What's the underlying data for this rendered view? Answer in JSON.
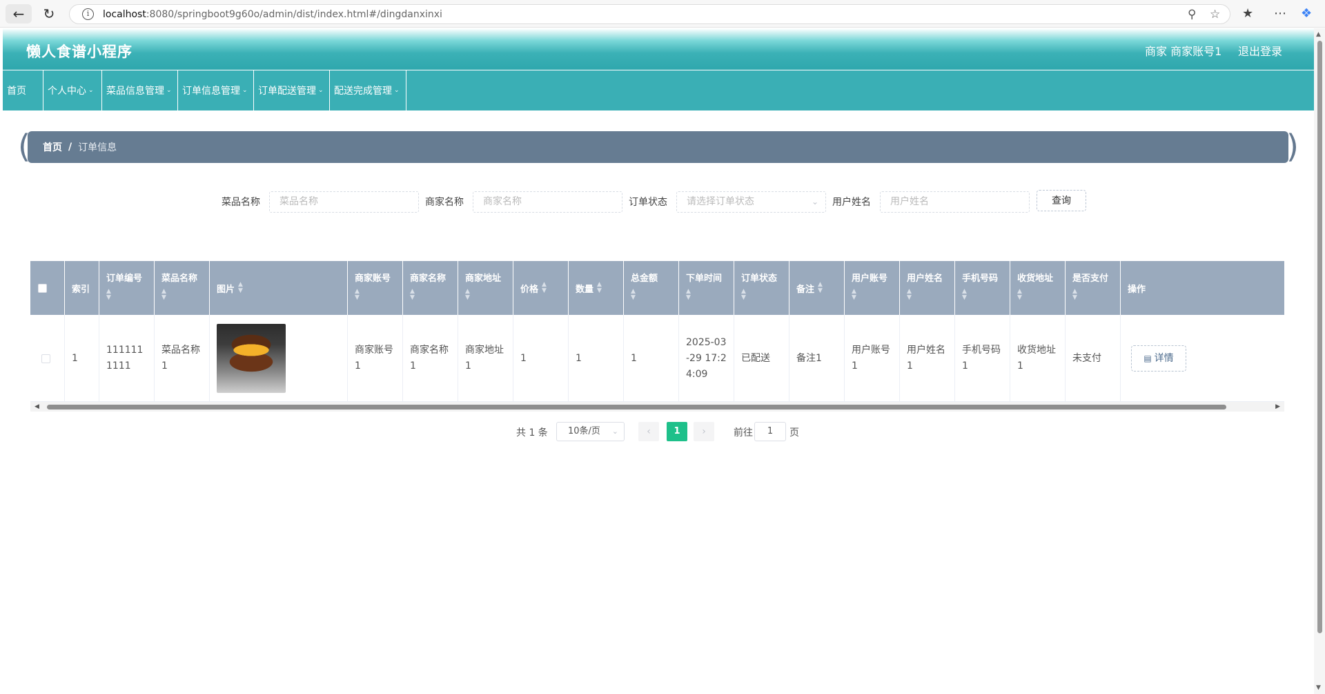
{
  "browser": {
    "url_host": "localhost",
    "url_rest": ":8080/springboot9g60o/admin/dist/index.html#/dingdanxinxi"
  },
  "header": {
    "title": "懒人食谱小程序",
    "user": "商家 商家账号1",
    "logout": "退出登录"
  },
  "menu": {
    "items": [
      {
        "label": "首页",
        "has_caret": false
      },
      {
        "label": "个人中心",
        "has_caret": true
      },
      {
        "label": "菜品信息管理",
        "has_caret": true
      },
      {
        "label": "订单信息管理",
        "has_caret": true
      },
      {
        "label": "订单配送管理",
        "has_caret": true
      },
      {
        "label": "配送完成管理",
        "has_caret": true
      }
    ]
  },
  "breadcrumb": {
    "home": "首页",
    "separator": "/",
    "current": "订单信息"
  },
  "search": {
    "fields": [
      {
        "label": "菜品名称",
        "placeholder": "菜品名称"
      },
      {
        "label": "商家名称",
        "placeholder": "商家名称"
      },
      {
        "label": "订单状态",
        "placeholder": "请选择订单状态"
      },
      {
        "label": "用户姓名",
        "placeholder": "用户姓名"
      }
    ],
    "query_button": "查询"
  },
  "table": {
    "columns": [
      "索引",
      "订单编号",
      "菜品名称",
      "图片",
      "商家账号",
      "商家名称",
      "商家地址",
      "价格",
      "数量",
      "总金额",
      "下单时间",
      "订单状态",
      "备注",
      "用户账号",
      "用户姓名",
      "手机号码",
      "收货地址",
      "是否支付",
      "操作"
    ],
    "rows": [
      {
        "index": "1",
        "order_no": "1111111111",
        "dish_name": "菜品名称1",
        "merchant_account": "商家账号1",
        "merchant_name": "商家名称1",
        "merchant_address": "商家地址1",
        "price": "1",
        "quantity": "1",
        "total": "1",
        "order_time": "2025-03-29 17:24:09",
        "status": "已配送",
        "remark": "备注1",
        "user_account": "用户账号1",
        "user_name": "用户姓名1",
        "phone": "手机号码1",
        "address": "收货地址1",
        "paid": "未支付",
        "action": "详情"
      }
    ]
  },
  "pagination": {
    "total_text": "共 1 条",
    "page_size": "10条/页",
    "current_page": "1",
    "goto_label": "前往",
    "goto_value": "1",
    "unit": "页"
  },
  "colors": {
    "header_teal": "#2fa7ad",
    "menu_teal": "#3aafb5",
    "breadcrumb_bg": "#667c92",
    "table_header_bg": "#9aaabd",
    "pagination_active": "#1ec08a"
  }
}
